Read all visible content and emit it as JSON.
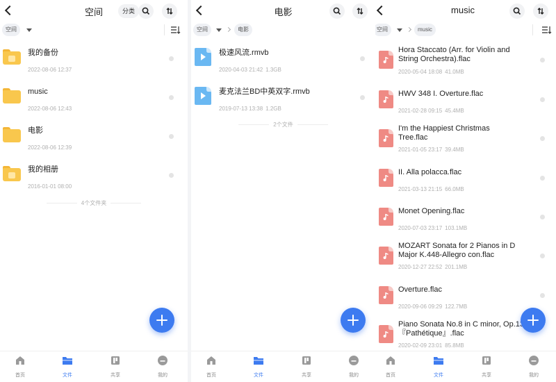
{
  "colors": {
    "accent": "#3d7bf0",
    "folder": "#f9c74d",
    "video": "#6ab8f2",
    "audio": "#ef8a84"
  },
  "tabbar": {
    "items": [
      {
        "label": "首页",
        "icon": "home-icon"
      },
      {
        "label": "文件",
        "icon": "folder-icon"
      },
      {
        "label": "共享",
        "icon": "share-icon"
      },
      {
        "label": "我的",
        "icon": "profile-icon"
      }
    ],
    "active": "文件"
  },
  "panel1": {
    "title": "空间",
    "category_button": "分类",
    "breadcrumb": [
      "空间"
    ],
    "items": [
      {
        "name": "我的备份",
        "date": "2022-08-06 12:37",
        "type": "folder",
        "badge": true
      },
      {
        "name": "music",
        "date": "2022-08-06 12:43",
        "type": "folder",
        "badge": false
      },
      {
        "name": "电影",
        "date": "2022-08-06 12:39",
        "type": "folder",
        "badge": false
      },
      {
        "name": "我的相册",
        "date": "2016-01-01 08:00",
        "type": "folder",
        "badge": true
      }
    ],
    "summary": "4个文件夹"
  },
  "panel2": {
    "title": "电影",
    "breadcrumb": [
      "空间",
      "电影"
    ],
    "items": [
      {
        "name": "极速风流.rmvb",
        "date": "2020-04-03 21:42",
        "size": "1.3GB"
      },
      {
        "name": "麦克法兰BD中英双字.rmvb",
        "date": "2019-07-13 13:38",
        "size": "1.2GB"
      }
    ],
    "summary": "2个文件"
  },
  "panel3": {
    "title": "music",
    "breadcrumb": [
      "空间",
      "music"
    ],
    "items": [
      {
        "name": "Hora Staccato (Arr. for Violin and String Orchestra).flac",
        "date": "2020-05-04 18:08",
        "size": "41.0MB"
      },
      {
        "name": "HWV 348 I. Overture.flac",
        "date": "2021-02-28 09:15",
        "size": "45.4MB"
      },
      {
        "name": "I'm the Happiest Christmas Tree.flac",
        "date": "2021-01-05 23:17",
        "size": "39.4MB"
      },
      {
        "name": "II. Alla polacca.flac",
        "date": "2021-03-13 21:15",
        "size": "66.0MB"
      },
      {
        "name": "Monet Opening.flac",
        "date": "2020-07-03 23:17",
        "size": "103.1MB"
      },
      {
        "name": "MOZART Sonata for 2 Pianos in D Major K.448-Allegro con.flac",
        "date": "2020-12-27 22:52",
        "size": "201.1MB"
      },
      {
        "name": "Overture.flac",
        "date": "2020-09-06 09:29",
        "size": "122.7MB"
      },
      {
        "name": "Piano Sonata No.8 in C minor, Op.13 『Pathétique』.flac",
        "date": "2020-02-09 23:01",
        "size": "85.8MB"
      }
    ]
  }
}
